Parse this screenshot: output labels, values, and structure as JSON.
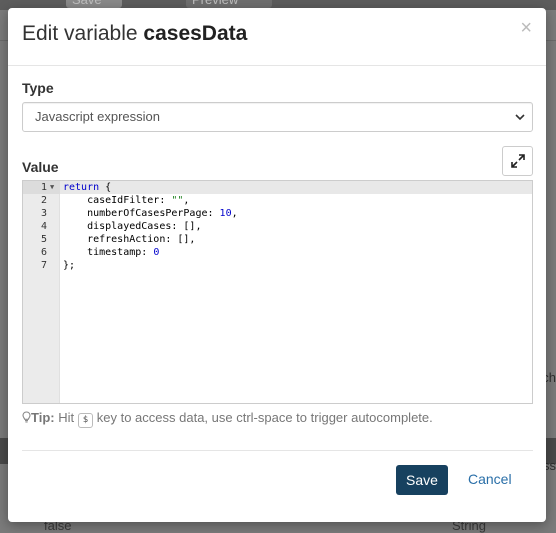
{
  "background": {
    "toolbar": {
      "save_label": "Save",
      "preview_label": "Preview"
    },
    "row_text": "false",
    "row_type": "String",
    "edge_text_right": [
      "ch",
      "ss"
    ]
  },
  "modal": {
    "title_prefix": "Edit variable ",
    "title_name": "casesData",
    "close_glyph": "×",
    "type_label": "Type",
    "type_value": "Javascript expression",
    "value_label": "Value",
    "code_lines": [
      {
        "num": "1",
        "text": "return {"
      },
      {
        "num": "2",
        "text": "    caseIdFilter: \"\","
      },
      {
        "num": "3",
        "text": "    numberOfCasesPerPage: 10,"
      },
      {
        "num": "4",
        "text": "    displayedCases: [],"
      },
      {
        "num": "5",
        "text": "    refreshAction: [],"
      },
      {
        "num": "6",
        "text": "    timestamp: 0"
      },
      {
        "num": "7",
        "text": "};"
      }
    ],
    "tip": {
      "label": "Tip:",
      "before": " Hit ",
      "key": "$",
      "after": " key to access data, use ctrl-space to trigger autocomplete."
    },
    "save_label": "Save",
    "cancel_label": "Cancel"
  },
  "colors": {
    "primary_button": "#17415f",
    "link": "#2a6fa8",
    "keyword": "#0000cc",
    "string": "#1a7f1a"
  }
}
